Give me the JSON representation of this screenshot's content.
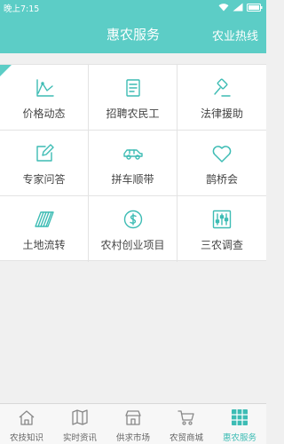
{
  "status_bar": {
    "time": "晚上7:15"
  },
  "header": {
    "title": "惠农服务",
    "hotline": "农业热线"
  },
  "grid": {
    "items": [
      {
        "label": "价格动态",
        "icon": "price-trend-icon"
      },
      {
        "label": "招聘农民工",
        "icon": "recruit-icon"
      },
      {
        "label": "法律援助",
        "icon": "gavel-icon"
      },
      {
        "label": "专家问答",
        "icon": "edit-icon"
      },
      {
        "label": "拼车顺带",
        "icon": "car-icon"
      },
      {
        "label": "鹊桥会",
        "icon": "heart-icon"
      },
      {
        "label": "土地流转",
        "icon": "land-icon"
      },
      {
        "label": "农村创业项目",
        "icon": "dollar-coin-icon"
      },
      {
        "label": "三农调查",
        "icon": "survey-icon"
      }
    ]
  },
  "tabs": [
    {
      "label": "农技知识",
      "icon": "home-icon",
      "active": false
    },
    {
      "label": "实时资讯",
      "icon": "map-icon",
      "active": false
    },
    {
      "label": "供求市场",
      "icon": "market-icon",
      "active": false
    },
    {
      "label": "农贸商城",
      "icon": "cart-icon",
      "active": false
    },
    {
      "label": "惠农服务",
      "icon": "grid-icon",
      "active": true
    }
  ],
  "colors": {
    "primary": "#5ccdc6",
    "active_tab": "#3dbcb4",
    "ribbon": "#5ccdc6"
  }
}
